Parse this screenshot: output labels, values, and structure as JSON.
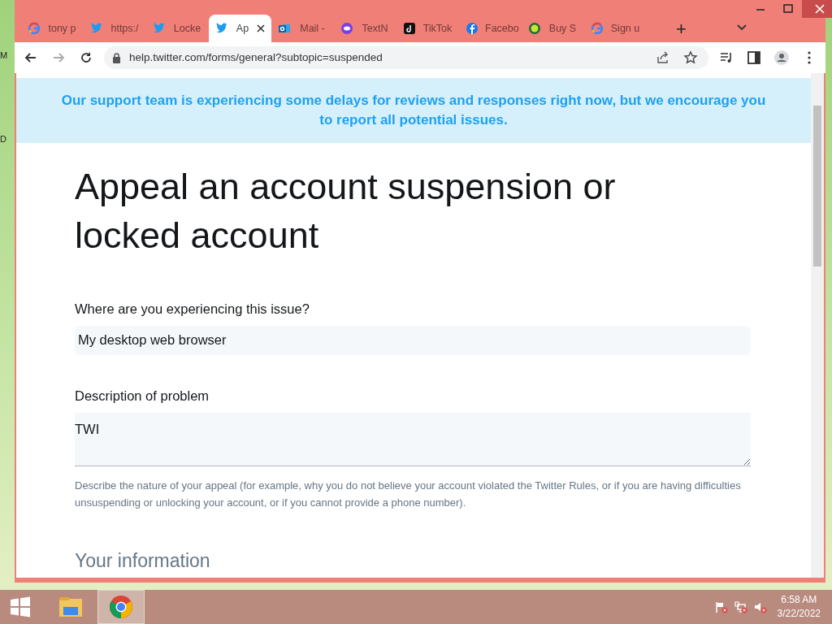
{
  "desktop_labels": [
    "M",
    "D"
  ],
  "tabs": [
    {
      "title": "tony p",
      "kind": "google",
      "selected": false
    },
    {
      "title": "https:/",
      "kind": "twitter",
      "selected": false
    },
    {
      "title": "Locke",
      "kind": "twitter",
      "selected": false
    },
    {
      "title": "Ap",
      "kind": "twitter",
      "selected": true
    },
    {
      "title": "Mail -",
      "kind": "outlook",
      "selected": false
    },
    {
      "title": "TextN",
      "kind": "textnow",
      "selected": false
    },
    {
      "title": "TikTok",
      "kind": "tiktok",
      "selected": false
    },
    {
      "title": "Facebo",
      "kind": "facebook",
      "selected": false
    },
    {
      "title": "Buy S",
      "kind": "chat",
      "selected": false
    },
    {
      "title": "Sign u",
      "kind": "google",
      "selected": false
    }
  ],
  "new_tab": "+",
  "address_bar": {
    "url": "help.twitter.com/forms/general?subtopic=suspended"
  },
  "banner": "Our support team is experiencing some delays for reviews and responses right now, but we encourage you to report all potential issues.",
  "heading": "Appeal an account suspension or locked account",
  "form": {
    "platform": {
      "label": "Where are you experiencing this issue?",
      "value": "My desktop web browser"
    },
    "description": {
      "label": "Description of problem",
      "value": "TWI",
      "help": "Describe the nature of your appeal (for example, why you do not believe your account violated the Twitter Rules, or if you are having difficulties unsuspending or unlocking your account, or if you cannot provide a phone number)."
    },
    "section": "Your information"
  },
  "taskbar": {
    "time": "6:58 AM",
    "date": "3/22/2022"
  }
}
